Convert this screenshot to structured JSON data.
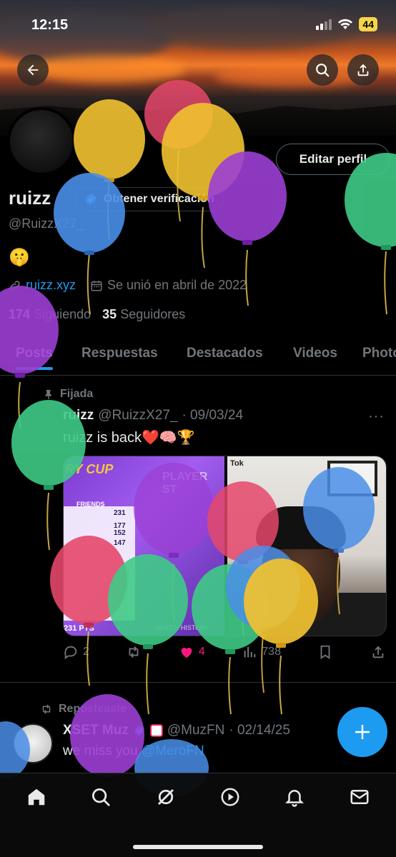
{
  "status_bar": {
    "time": "12:15",
    "battery": "44"
  },
  "profile": {
    "name": "ruizz",
    "verify_label": "Obtener verificación",
    "handle": "@RuizzX27_",
    "bio": "🤫",
    "website": "ruizz.xyz",
    "joined": "Se unió en abril de 2022",
    "following_count": "174",
    "following_label": "Siguiendo",
    "followers_count": "35",
    "followers_label": "Seguidores",
    "edit_label": "Editar perfil"
  },
  "tabs": [
    {
      "label": "Posts",
      "active": true
    },
    {
      "label": "Respuestas",
      "active": false
    },
    {
      "label": "Destacados",
      "active": false
    },
    {
      "label": "Videos",
      "active": false
    },
    {
      "label": "Photos",
      "active": false
    }
  ],
  "pinned_post": {
    "pinned_label": "Fijada",
    "author": "ruizz",
    "handle": "@RuizzX27_",
    "date": "· 09/03/24",
    "text": "ruizz is back❤️🧠🏆",
    "media_left_title": "RY CUP",
    "media_left_subtitle": "PLAYER ST",
    "media_left_tab": "FRIENDS",
    "media_left_rows": [
      "231",
      "177",
      "152",
      "147"
    ],
    "media_left_score": "231 PTS",
    "media_left_footer": "MATCH HISTORY",
    "media_right_label": "Tok",
    "replies": "2",
    "likes": "4",
    "views": "738"
  },
  "second_post": {
    "repost_label": "Reposteaste",
    "author": "XSET Muz",
    "handle": "@MuzFN",
    "date": "· 02/14/25",
    "text_prefix": "we miss you ",
    "mention": "@MeroFN"
  },
  "colors": {
    "accent": "#1d9bf0",
    "like": "#f91880",
    "background": "#000000",
    "muted": "#71767b"
  },
  "icons": {
    "back": "arrow-left-icon",
    "search": "search-icon",
    "share": "share-icon",
    "nav": [
      "home-icon",
      "search-icon",
      "grok-icon",
      "video-icon",
      "bell-icon",
      "mail-icon"
    ]
  }
}
